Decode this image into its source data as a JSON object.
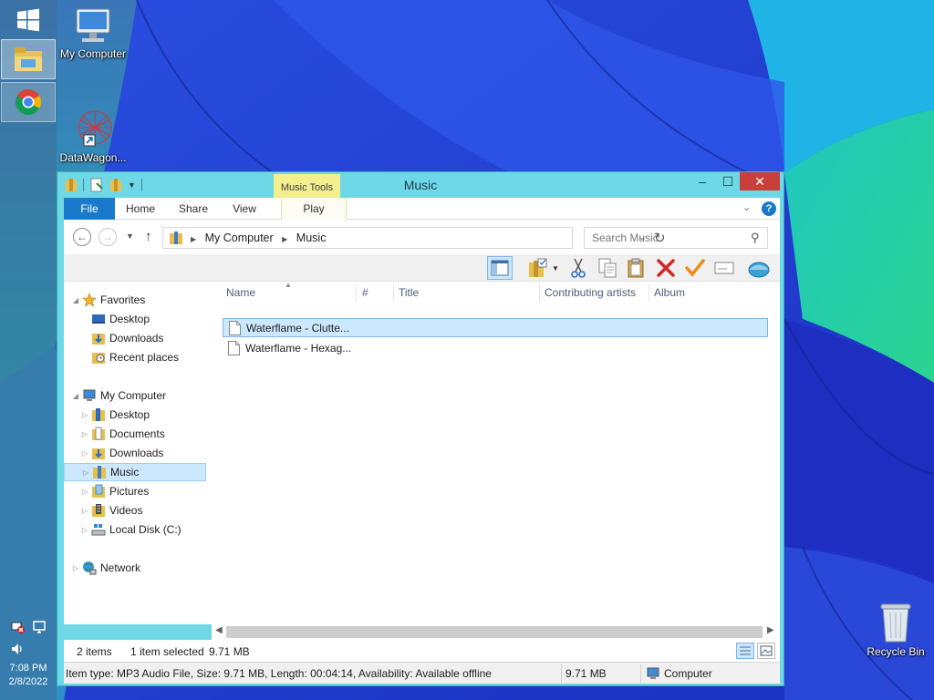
{
  "desktop": {
    "icons": [
      {
        "label": "My Computer"
      },
      {
        "label": "DataWagon..."
      },
      {
        "label": "Recycle Bin"
      }
    ]
  },
  "taskbar": {
    "apps": [
      {
        "name": "windows-start-icon"
      },
      {
        "name": "file-explorer-icon"
      },
      {
        "name": "chrome-icon"
      }
    ],
    "clock": {
      "time": "7:08 PM",
      "date": "2/8/2022"
    }
  },
  "window": {
    "title": "Music",
    "context_tab_header": "Music Tools",
    "ribbon_tabs": [
      {
        "label": "File"
      },
      {
        "label": "Home"
      },
      {
        "label": "Share"
      },
      {
        "label": "View"
      },
      {
        "label": "Play"
      }
    ],
    "address": {
      "crumbs": [
        "My Computer",
        "Music"
      ],
      "separator": "▸"
    },
    "search": {
      "placeholder": "Search Music"
    },
    "toolbar": [
      "layout-icon",
      "properties-folder-icon",
      "cut-icon",
      "copy-icon",
      "paste-icon",
      "delete-icon",
      "checkmark-icon",
      "rename-icon",
      "globe-icon"
    ]
  },
  "nav_pane": {
    "favorites": {
      "label": "Favorites",
      "items": [
        {
          "label": "Desktop"
        },
        {
          "label": "Downloads"
        },
        {
          "label": "Recent places"
        }
      ]
    },
    "computer": {
      "label": "My Computer",
      "items": [
        {
          "label": "Desktop"
        },
        {
          "label": "Documents"
        },
        {
          "label": "Downloads"
        },
        {
          "label": "Music"
        },
        {
          "label": "Pictures"
        },
        {
          "label": "Videos"
        },
        {
          "label": "Local Disk (C:)"
        }
      ]
    },
    "network": {
      "label": "Network"
    }
  },
  "file_list": {
    "columns": [
      "Name",
      "#",
      "Title",
      "Contributing artists",
      "Album"
    ],
    "rows": [
      {
        "name": "Waterflame - Clutte...",
        "selected": true
      },
      {
        "name": "Waterflame - Hexag...",
        "selected": false
      }
    ]
  },
  "status": {
    "items_count": "2 items",
    "selected": "1 item selected",
    "size": "9.71 MB"
  },
  "details": {
    "info": "Item type: MP3 Audio File, Size: 9.71 MB, Length: 00:04:14, Availability: Available offline",
    "size": "9.71 MB",
    "location": "Computer"
  },
  "colors": {
    "accent": "#1979ca",
    "window_frame": "#6fd8e6",
    "selection": "#cce8ff",
    "close_button": "#c7413a",
    "context_tab": "#f4ef8e"
  }
}
